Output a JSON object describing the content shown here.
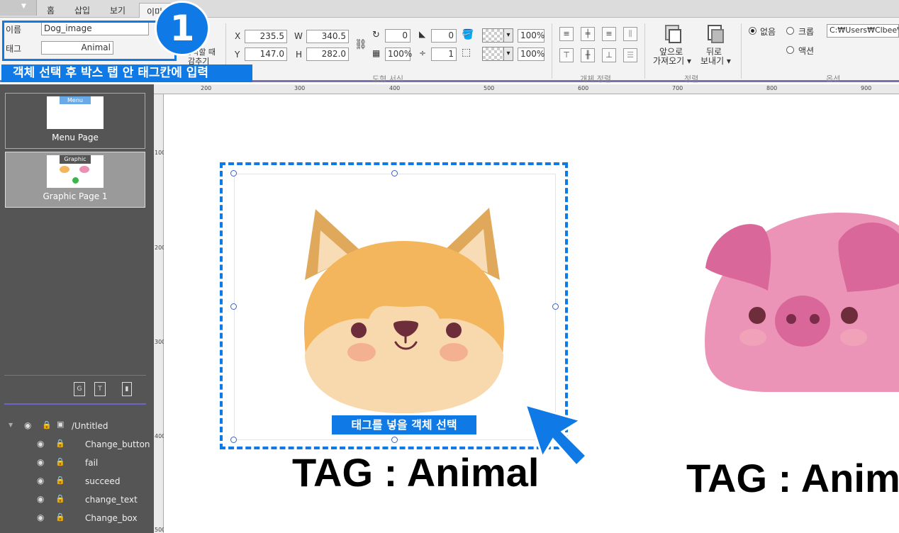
{
  "tabs": [
    "홈",
    "삽입",
    "보기",
    "이미지"
  ],
  "ribbon": {
    "name_label": "이름",
    "name_value": "Dog_image",
    "tag_label": "태그",
    "tag_value": "Animal",
    "hide_label_1": "클릭할 때",
    "hide_label_2": "감추기",
    "x_label": "X",
    "x_value": "235.5",
    "y_label": "Y",
    "y_value": "147.0",
    "w_label": "W",
    "w_value": "340.5",
    "h_label": "H",
    "h_value": "282.0",
    "rotation": "0",
    "corner": "0",
    "opacity": "100%",
    "line_width": "1",
    "fill_pct": "100%",
    "line_pct": "100%",
    "group_shape": "도형 서식",
    "group_align": "개체 정렬",
    "bring_front_1": "앞으로",
    "bring_front_2": "가져오기 ▾",
    "send_back_1": "뒤로",
    "send_back_2": "보내기 ▾",
    "group_order": "정렬",
    "opt_none": "없음",
    "opt_crop": "크롭",
    "opt_action": "액션",
    "path_value": "C:₩Users₩Clbee₩",
    "group_options": "옵션"
  },
  "pages": [
    {
      "caption": "Menu Page",
      "badge": "Menu"
    },
    {
      "caption": "Graphic Page 1",
      "badge": "Graphic"
    }
  ],
  "layers": {
    "root": "/Untitled",
    "items": [
      "Change_button",
      "fail",
      "succeed",
      "change_text",
      "Change_box"
    ]
  },
  "ruler_top": [
    "200",
    "300",
    "400",
    "500",
    "600",
    "700",
    "800",
    "900"
  ],
  "ruler_left": [
    "100",
    "200",
    "300",
    "400",
    "500"
  ],
  "callouts": {
    "step_number": "1",
    "instruction": "객체 선택 후 박스 탭 안 태그칸에 입력",
    "select_hint": "태그를 넣을 객체 선택"
  },
  "tag_dog": "TAG : Animal",
  "tag_pig": "TAG : Anim",
  "colors": {
    "accent": "#0f7ae5",
    "dog": "#f4b65c",
    "pig": "#ec8fb4"
  }
}
